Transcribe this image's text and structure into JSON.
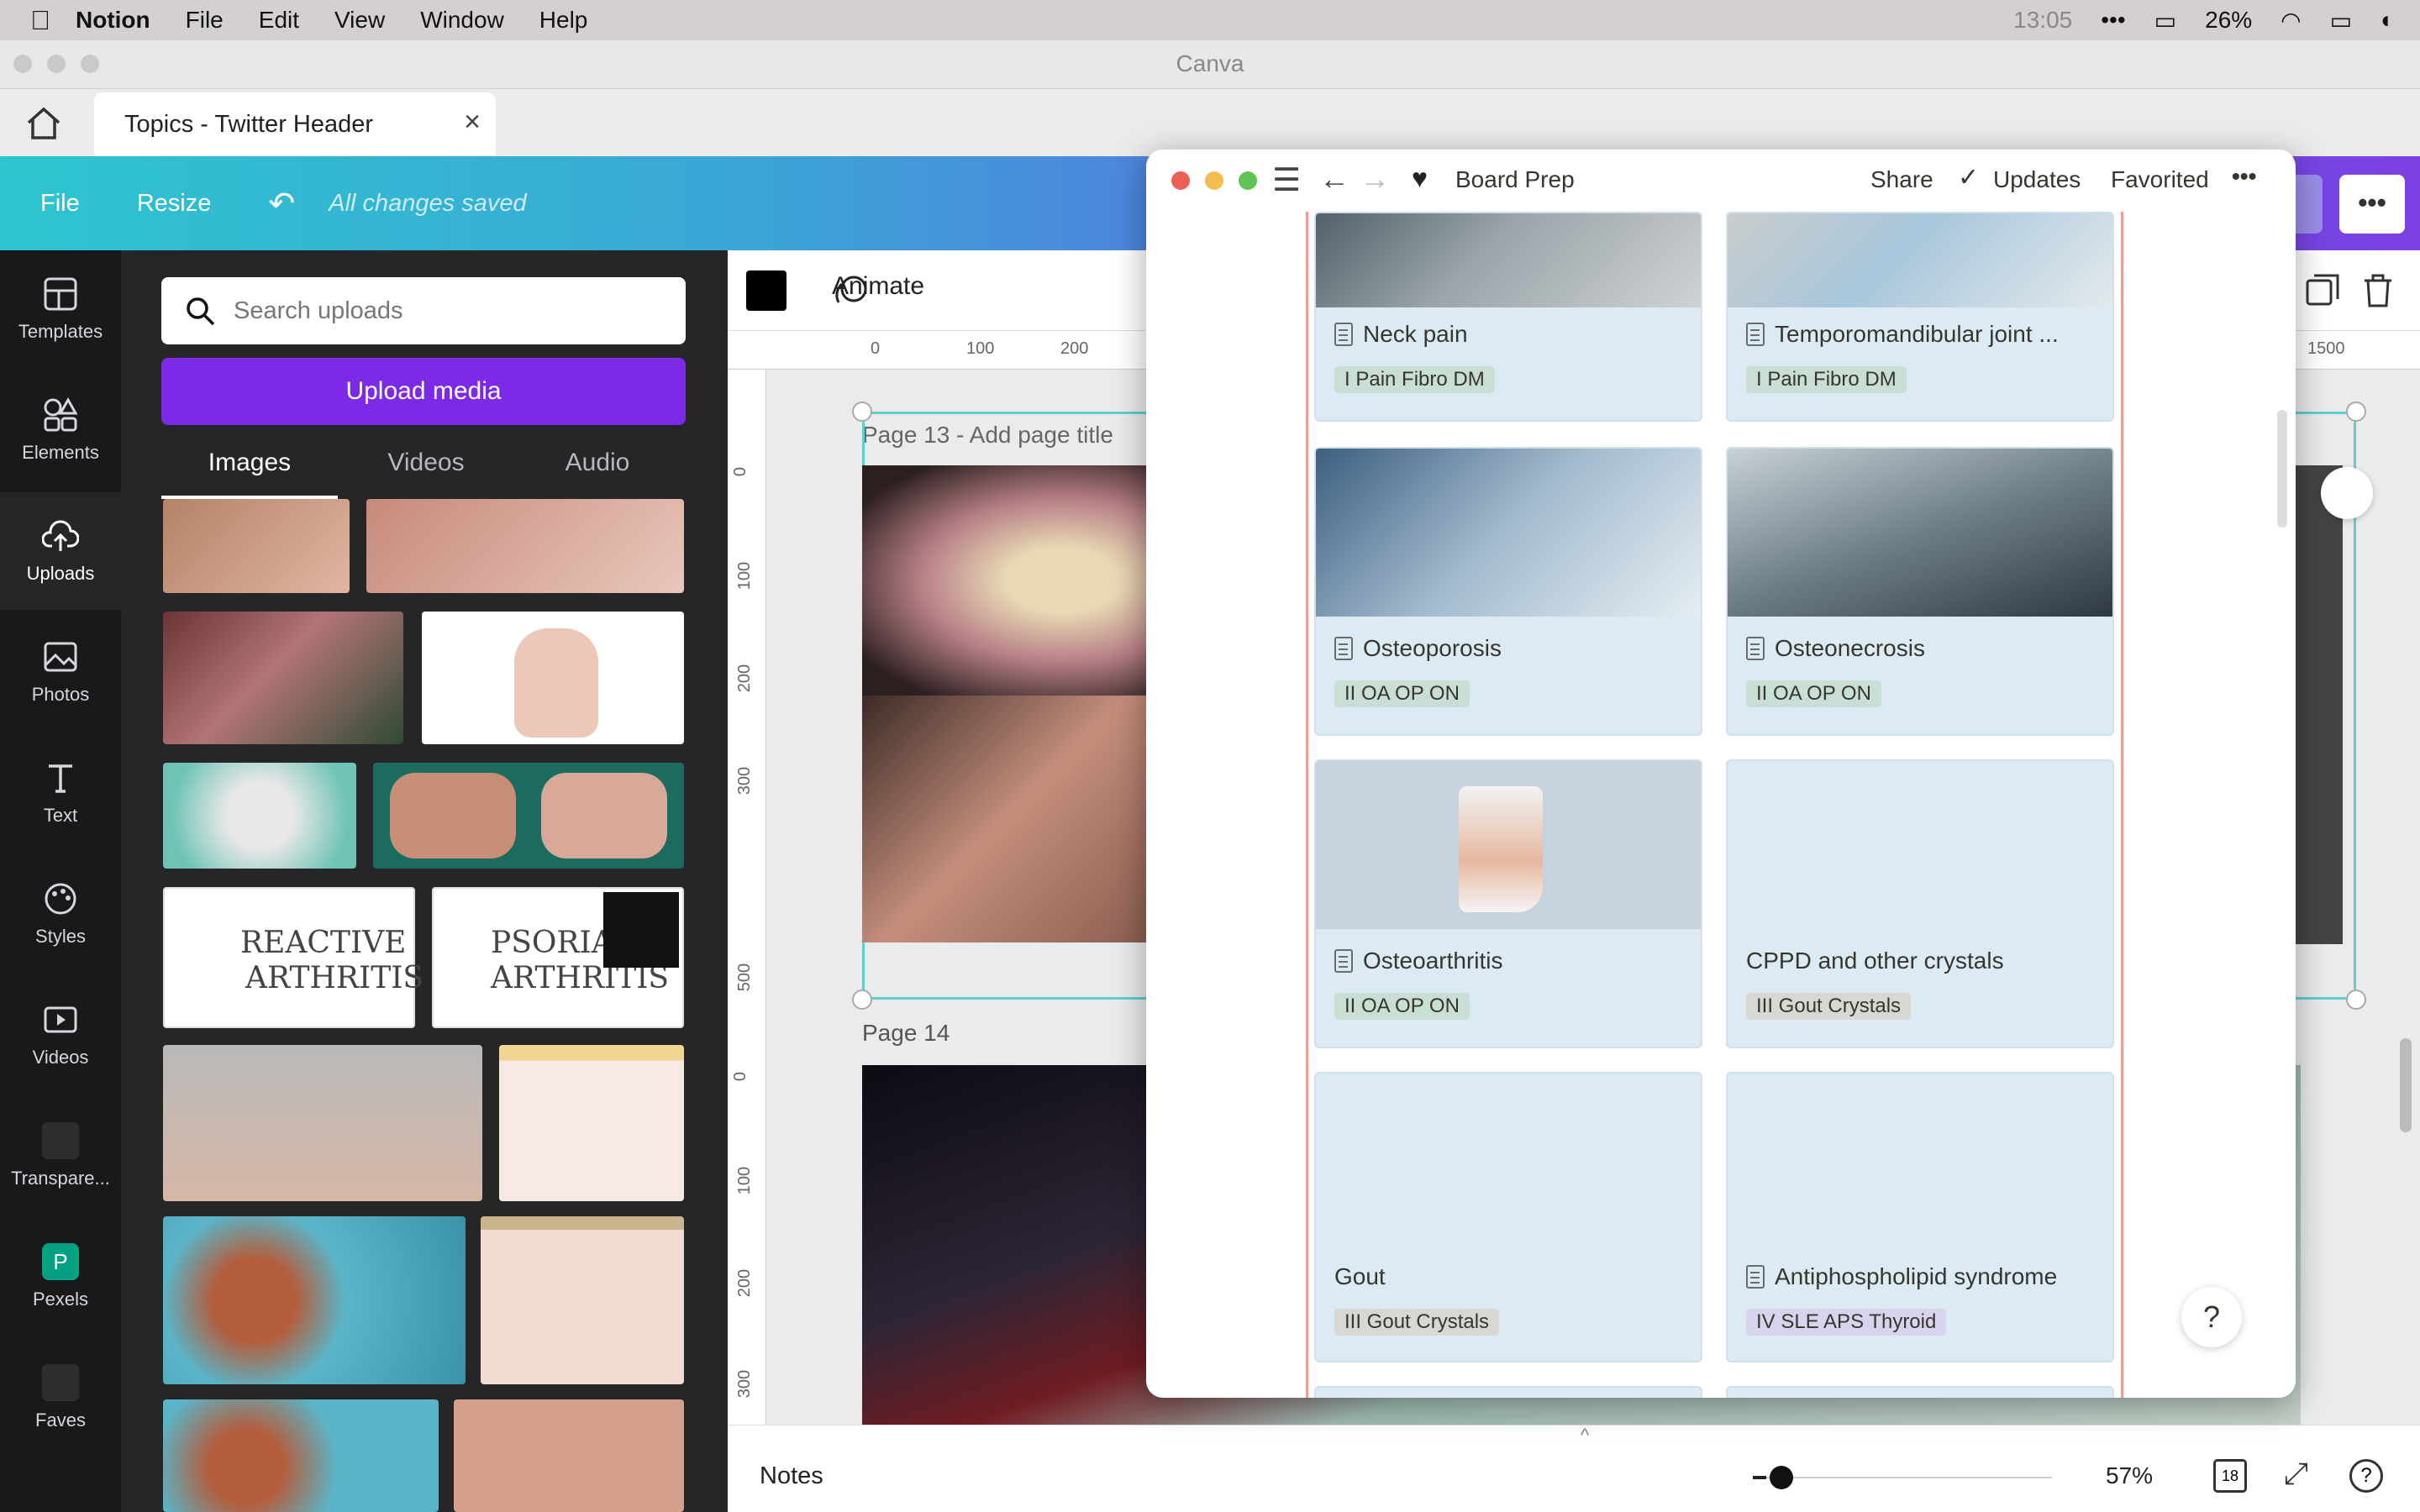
{
  "menubar": {
    "app": "Notion",
    "items": [
      "File",
      "Edit",
      "View",
      "Window",
      "Help"
    ],
    "time": "13:05",
    "battery": "26%"
  },
  "window": {
    "title": "Canva"
  },
  "tab": {
    "label": "Topics - Twitter Header"
  },
  "toolbar": {
    "file": "File",
    "resize": "Resize",
    "saved": "All changes saved"
  },
  "rail": [
    {
      "label": "Templates",
      "icon": "templates-icon"
    },
    {
      "label": "Elements",
      "icon": "elements-icon"
    },
    {
      "label": "Uploads",
      "icon": "upload-cloud-icon"
    },
    {
      "label": "Photos",
      "icon": "photos-icon"
    },
    {
      "label": "Text",
      "icon": "text-icon"
    },
    {
      "label": "Styles",
      "icon": "styles-icon"
    },
    {
      "label": "Videos",
      "icon": "videos-icon"
    },
    {
      "label": "Transpare...",
      "icon": "transparency-icon"
    },
    {
      "label": "Pexels",
      "icon": "pexels-icon"
    },
    {
      "label": "Faves",
      "icon": "faves-icon"
    }
  ],
  "uploads": {
    "placeholder": "Search uploads",
    "upload_button": "Upload media",
    "tabs": [
      "Images",
      "Videos",
      "Audio"
    ]
  },
  "editor": {
    "animate": "Animate",
    "ruler_top": [
      "0",
      "100",
      "200",
      "1500"
    ],
    "ruler_left": [
      "0",
      "100",
      "200",
      "300",
      "500",
      "0",
      "100",
      "200",
      "300"
    ],
    "page13": "Page 13 - Add page title",
    "page14": "Page 14"
  },
  "bottombar": {
    "notes": "Notes",
    "zoom": "57%",
    "pages": "18"
  },
  "notion": {
    "breadcrumb": "Board Prep",
    "share": "Share",
    "updates": "Updates",
    "favorited": "Favorited",
    "help": "?",
    "cards": [
      {
        "title": "Neck pain",
        "tag": "I Pain Fibro DM",
        "icon": true
      },
      {
        "title": "Temporomandibular joint ...",
        "tag": "I Pain Fibro DM",
        "icon": true
      },
      {
        "title": "Osteoporosis",
        "tag": "II OA OP ON",
        "icon": true
      },
      {
        "title": "Osteonecrosis",
        "tag": "II OA OP ON",
        "icon": true
      },
      {
        "title": "Osteoarthritis",
        "tag": "II OA OP ON",
        "icon": true
      },
      {
        "title": "CPPD and other crystals",
        "tag": "III Gout Crystals",
        "icon": false
      },
      {
        "title": "Gout",
        "tag": "III Gout Crystals",
        "icon": false
      },
      {
        "title": "Antiphospholipid syndrome",
        "tag": "IV SLE APS Thyroid",
        "icon": true
      }
    ]
  },
  "colors": {
    "tag_green": "#c9dfd6",
    "tag_gray": "#d8d7d4",
    "tag_purple": "#d9d3ee",
    "upload_button": "#7d2ae8",
    "card_bg": "#dcebf3"
  }
}
